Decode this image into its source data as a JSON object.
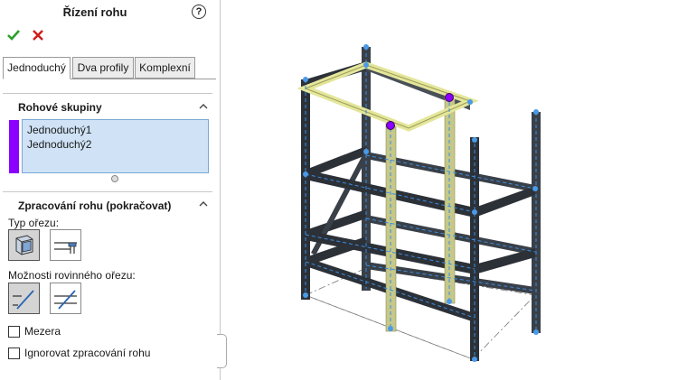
{
  "panel": {
    "title": "Řízení rohu",
    "help_icon": "?",
    "ok_icon": "check-icon",
    "cancel_icon": "close-icon",
    "tabs": [
      {
        "label": "Jednoduchý",
        "active": true
      },
      {
        "label": "Dva profily",
        "active": false
      },
      {
        "label": "Komplexní",
        "active": false
      }
    ],
    "corner_groups": {
      "title": "Rohové skupiny",
      "items": [
        "Jednoduchý1",
        "Jednoduchý2"
      ],
      "color": "#8b00ff"
    },
    "corner_processing": {
      "title": "Zpracování rohu (pokračovat)",
      "trim_type_label": "Typ ořezu:",
      "planar_trim_label": "Možnosti rovinného ořezu:",
      "gap_label": "Mezera",
      "ignore_label": "Ignorovat zpracování rohu",
      "gap_checked": false,
      "ignore_checked": false
    }
  },
  "colors": {
    "accent_ok": "#2aa02a",
    "accent_cancel": "#d11a1a",
    "selection_bg": "#cfe2f6",
    "frame_dark": "#2c3138",
    "highlight_yellow": "#e4e69a"
  }
}
